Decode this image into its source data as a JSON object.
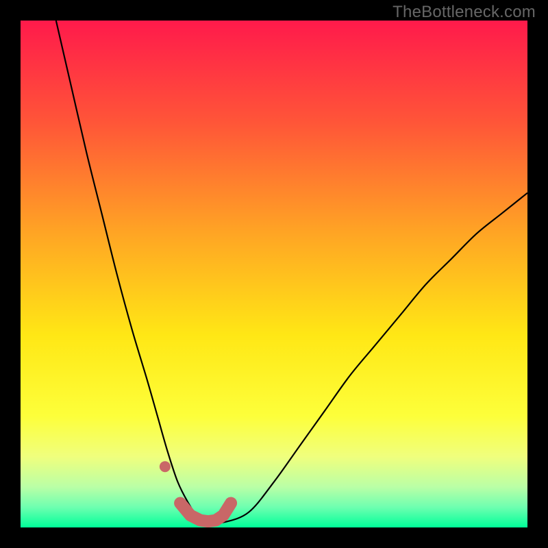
{
  "watermark": "TheBottleneck.com",
  "chart_data": {
    "type": "line",
    "title": "",
    "xlabel": "",
    "ylabel": "",
    "xlim": [
      0,
      100
    ],
    "ylim": [
      0,
      100
    ],
    "background_gradient": [
      {
        "offset": 0.0,
        "color": "#ff1a4b"
      },
      {
        "offset": 0.2,
        "color": "#ff5538"
      },
      {
        "offset": 0.42,
        "color": "#ffa524"
      },
      {
        "offset": 0.62,
        "color": "#ffe715"
      },
      {
        "offset": 0.78,
        "color": "#fdff3a"
      },
      {
        "offset": 0.86,
        "color": "#f0ff7d"
      },
      {
        "offset": 0.92,
        "color": "#baffa6"
      },
      {
        "offset": 0.96,
        "color": "#6effb0"
      },
      {
        "offset": 1.0,
        "color": "#00ff99"
      }
    ],
    "series": [
      {
        "name": "bottleneck-curve",
        "type": "line",
        "stroke": "#000000",
        "x": [
          7,
          10,
          13,
          16,
          19,
          22,
          25,
          27,
          29,
          31,
          33,
          35,
          37,
          40,
          45,
          50,
          55,
          60,
          65,
          70,
          75,
          80,
          85,
          90,
          95,
          100
        ],
        "y": [
          100,
          87,
          74,
          62,
          50,
          39,
          29,
          22,
          15,
          9,
          5,
          2,
          1,
          1,
          3,
          9,
          16,
          23,
          30,
          36,
          42,
          48,
          53,
          58,
          62,
          66
        ]
      },
      {
        "name": "bottleneck-markers",
        "type": "scatter",
        "stroke": "#c96767",
        "x": [
          28.5,
          31.5,
          33.5,
          35.5,
          37.0,
          38.5,
          40.0,
          41.5
        ],
        "y": [
          12.0,
          4.8,
          2.4,
          1.4,
          1.2,
          1.4,
          2.4,
          4.8
        ]
      }
    ]
  },
  "plot": {
    "inner_left": 30,
    "inner_top": 30,
    "inner_width": 740,
    "inner_height": 740
  }
}
